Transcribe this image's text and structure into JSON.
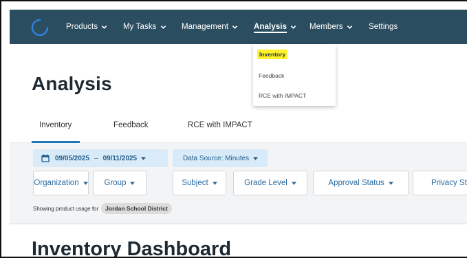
{
  "nav": {
    "items": [
      {
        "label": "Products",
        "has_dropdown": true
      },
      {
        "label": "My Tasks",
        "has_dropdown": true
      },
      {
        "label": "Management",
        "has_dropdown": true
      },
      {
        "label": "Analysis",
        "has_dropdown": true,
        "active": true
      },
      {
        "label": "Members",
        "has_dropdown": true
      },
      {
        "label": "Settings",
        "has_dropdown": false
      }
    ],
    "bg_color": "#2b4d60"
  },
  "dropdown": {
    "items": [
      {
        "label": "Inventory",
        "highlighted": true
      },
      {
        "label": "Feedback"
      },
      {
        "label": "RCE with IMPACT"
      }
    ]
  },
  "page": {
    "title": "Analysis"
  },
  "tabs": [
    {
      "label": "Inventory",
      "active": true
    },
    {
      "label": "Feedback"
    },
    {
      "label": "RCE with IMPACT"
    }
  ],
  "filters": {
    "date_start": "09/05/2025",
    "date_sep": "–",
    "date_end": "09/11/2025",
    "data_source": "Data Source: Minutes",
    "buttons": [
      "Organization",
      "Group",
      "Subject",
      "Grade Level",
      "Approval Status",
      "Privacy Sta"
    ],
    "showing_text": "Showing product usage for",
    "district": "Jordan School District"
  },
  "dashboard": {
    "title": "Inventory Dashboard"
  },
  "colors": {
    "accent": "#1f78b4",
    "highlight": "#fff22a",
    "chip_bg": "#d9ebf8"
  }
}
